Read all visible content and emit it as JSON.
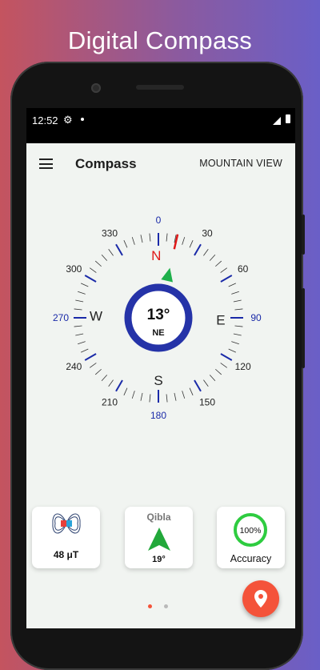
{
  "promo": {
    "title": "Digital Compass"
  },
  "status_bar": {
    "time": "12:52"
  },
  "app_bar": {
    "title": "Compass",
    "location": "MOUNTAIN VIEW"
  },
  "compass": {
    "heading_value": "13°",
    "heading_direction": "NE",
    "heading_degrees": 13,
    "cardinals": [
      "N",
      "E",
      "S",
      "W"
    ],
    "degree_labels": [
      {
        "text": "0",
        "highlight": true
      },
      {
        "text": "30",
        "highlight": false
      },
      {
        "text": "60",
        "highlight": false
      },
      {
        "text": "90",
        "highlight": true
      },
      {
        "text": "120",
        "highlight": false
      },
      {
        "text": "150",
        "highlight": false
      },
      {
        "text": "180",
        "highlight": true
      },
      {
        "text": "210",
        "highlight": false
      },
      {
        "text": "240",
        "highlight": false
      },
      {
        "text": "270",
        "highlight": true
      },
      {
        "text": "300",
        "highlight": false
      },
      {
        "text": "330",
        "highlight": false
      }
    ],
    "colors": {
      "ring": "#2533a8",
      "north": "#e01919",
      "highlight_label": "#1a2aa8",
      "pointer": "#1eb04b"
    }
  },
  "cards": {
    "magnetic": {
      "value": "48 μT",
      "icon": "magnetic-field-icon"
    },
    "qibla": {
      "title": "Qibla",
      "value": "19°",
      "icon": "qibla-arrow-icon"
    },
    "accuracy": {
      "percent_text": "100%",
      "percent_value": 100,
      "label": "Accuracy",
      "ring_color": "#2ecc40"
    }
  },
  "pager": {
    "pages": 2,
    "active": 0,
    "active_color": "#f4533a"
  },
  "fab": {
    "icon": "location-pin-icon",
    "color": "#f4533a"
  }
}
